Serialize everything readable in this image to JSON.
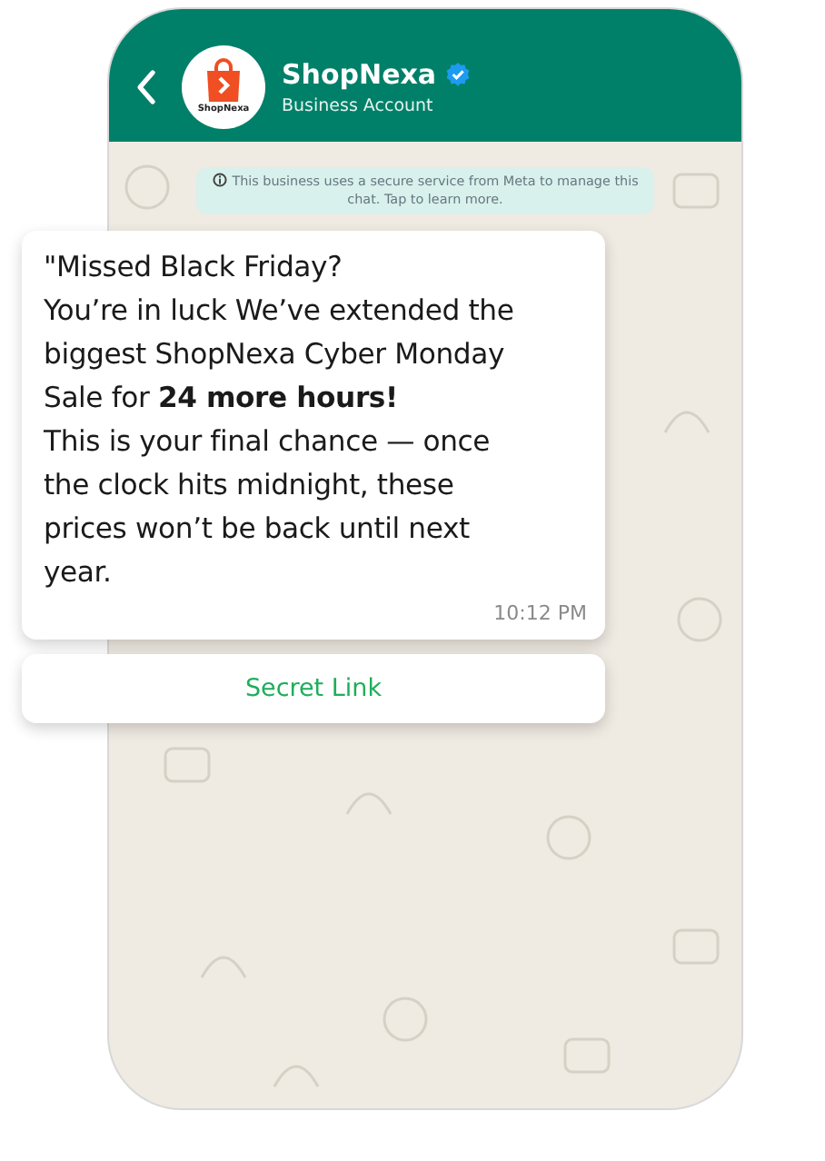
{
  "header": {
    "logo_text": "ShopNexa",
    "title": "ShopNexa",
    "verified": true,
    "subtitle": "Business Account"
  },
  "notice": "This business uses a secure service from Meta to manage this chat. Tap to learn more.",
  "message": {
    "text": "\"Missed Black Friday?\nYou’re in luck We’ve extended the biggest ShopNexa Cyber Monday Sale for **24 more hours!**\nThis is your final chance — once the clock hits midnight, these prices won’t be back until next year.",
    "time": "10:12 PM"
  },
  "buttons": [
    "Secret Link"
  ]
}
